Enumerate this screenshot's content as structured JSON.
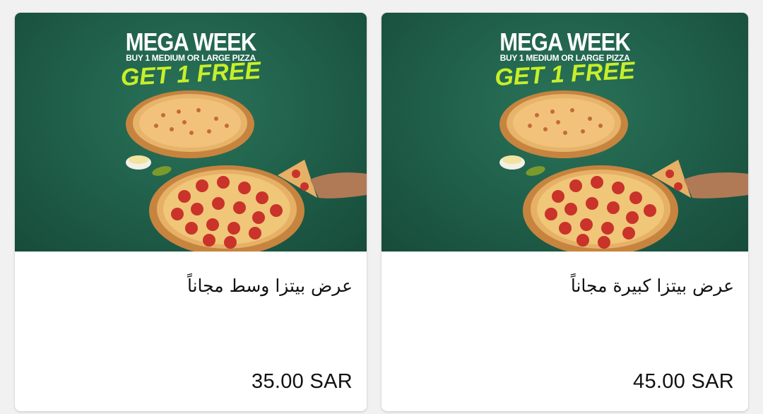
{
  "products": [
    {
      "promo": {
        "headline": "MEGA WEEK",
        "subline": "BUY 1 MEDIUM OR LARGE PIZZA",
        "cta": "GET 1 FREE"
      },
      "title": "عرض بيتزا وسط مجاناً",
      "price": "35.00 SAR"
    },
    {
      "promo": {
        "headline": "MEGA WEEK",
        "subline": "BUY 1 MEDIUM OR LARGE PIZZA",
        "cta": "GET 1 FREE"
      },
      "title": "عرض بيتزا كبيرة مجاناً",
      "price": "45.00 SAR"
    }
  ],
  "colors": {
    "background": "#f1f1f1",
    "card": "#ffffff",
    "promo_green": "#1f5e49",
    "accent_lime": "#c6ef2a"
  },
  "icons": [
    "pizza-image",
    "pepperoni-pizza-image",
    "dip-cup-image",
    "hand-slice-image"
  ]
}
